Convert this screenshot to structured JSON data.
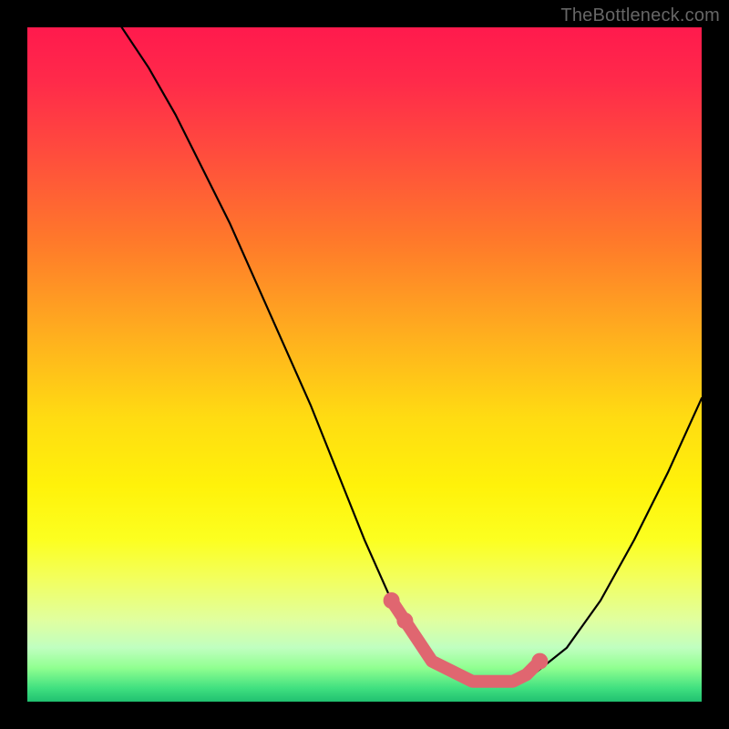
{
  "watermark": "TheBottleneck.com",
  "chart_data": {
    "type": "line",
    "title": "",
    "xlabel": "",
    "ylabel": "",
    "xlim": [
      0,
      100
    ],
    "ylim": [
      0,
      100
    ],
    "series": [
      {
        "name": "curve",
        "x": [
          14,
          18,
          22,
          26,
          30,
          34,
          38,
          42,
          46,
          50,
          54,
          57,
          60,
          63,
          66,
          69,
          72,
          75,
          80,
          85,
          90,
          95,
          100
        ],
        "values": [
          100,
          94,
          87,
          79,
          71,
          62,
          53,
          44,
          34,
          24,
          15,
          10,
          6,
          4,
          3,
          3,
          3,
          4,
          8,
          15,
          24,
          34,
          45
        ]
      }
    ],
    "highlight": {
      "name": "lowband",
      "color": "#e06670",
      "points_x": [
        54,
        56,
        58,
        60,
        62,
        64,
        66,
        68,
        70,
        72,
        74,
        76
      ],
      "points_values": [
        15,
        12,
        9,
        6,
        5,
        4,
        3,
        3,
        3,
        3,
        4,
        6
      ]
    }
  }
}
